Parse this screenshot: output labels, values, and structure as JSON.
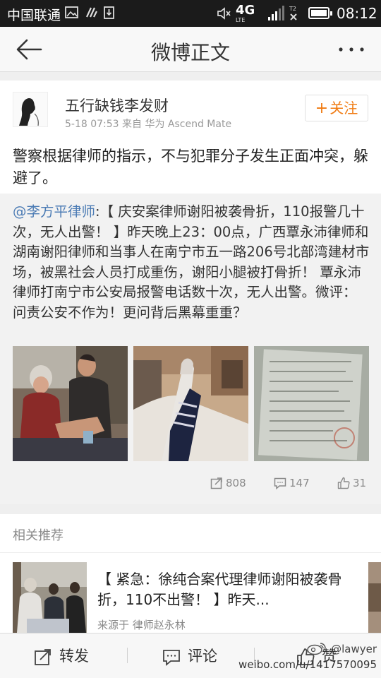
{
  "status_bar": {
    "carrier": "中国联通",
    "network": "4G",
    "network_sub": "LTE",
    "time": "08:12"
  },
  "title_bar": {
    "title": "微博正文",
    "back_icon": "back-arrow-icon",
    "more_icon": "more-dots-icon"
  },
  "post": {
    "username": "五行缺钱李发财",
    "meta": "5-18 07:53  来自 华为 Ascend Mate",
    "follow_label": "关注",
    "text": "警察根据律师的指示，不与犯罪分子发生正面冲突，躲避了。",
    "repost": {
      "mention": "@李方平律师",
      "text": ":【 庆安案律师谢阳被袭骨折，110报警几十次，无人出警！ 】昨天晚上23：00点，广西覃永沛律师和湖南谢阳律师和当事人在南宁市五一路206号北部湾建材市场，被黑社会人员打成重伤，谢阳小腿被打骨折！ 覃永沛律师打南宁市公安局报警电话数十次，无人出警。微评：问责公安不作为！更问背后黑幕重重？",
      "photos": [
        "hospital-visit-photo",
        "injured-leg-photo",
        "police-report-document-photo"
      ],
      "reposts": "808",
      "comments": "147",
      "likes": "31"
    }
  },
  "related": {
    "title": "相关推荐",
    "item": {
      "text": "【 紧急：徐纯合案代理律师谢阳被袭骨折，110不出警！ 】昨天...",
      "source": "来源于 律师赵永林"
    }
  },
  "bottom_bar": {
    "repost_label": "转发",
    "comment_label": "评论",
    "like_label": "赞"
  },
  "watermark": {
    "user": "@lawyer",
    "url": "weibo.com/u/1417570095"
  },
  "colors": {
    "accent_orange": "#f07b13",
    "link_blue": "#4b7bb4",
    "status_bar_bg": "#1b1b1b"
  }
}
